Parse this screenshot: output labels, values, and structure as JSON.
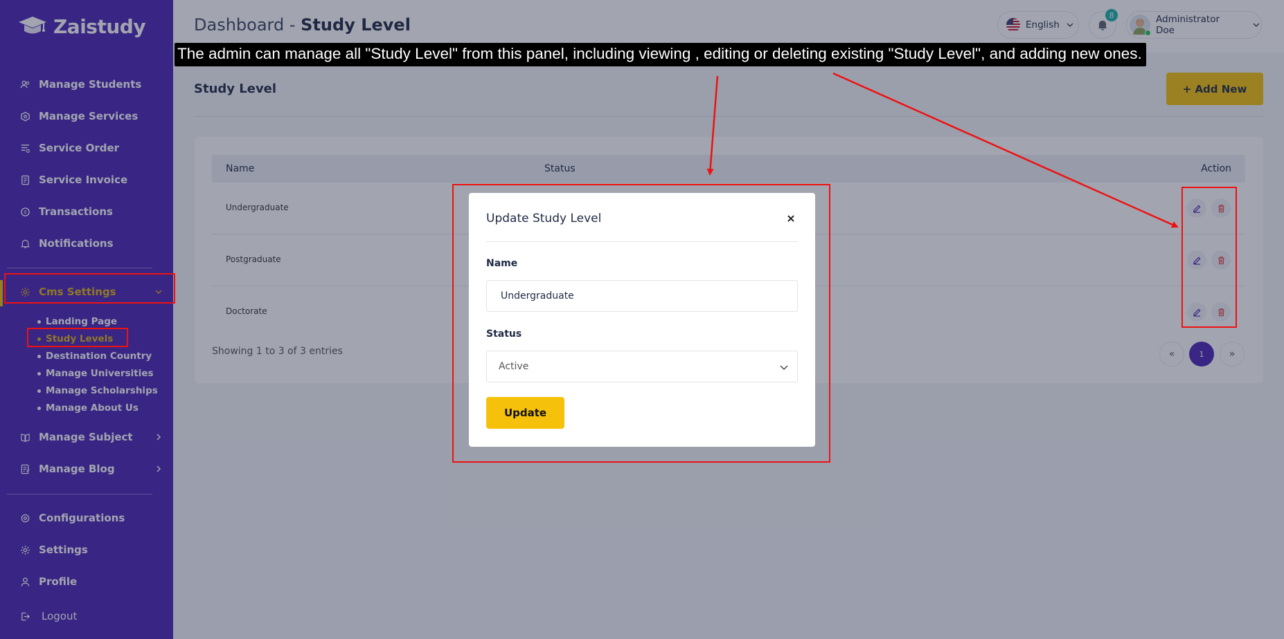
{
  "app": {
    "name": "Zaistudy",
    "logo_icon": "graduation-cap-logo"
  },
  "sidebar": {
    "items": [
      {
        "label": "Manage Students",
        "icon": "students-icon"
      },
      {
        "label": "Manage Services",
        "icon": "services-icon"
      },
      {
        "label": "Service Order",
        "icon": "order-icon"
      },
      {
        "label": "Service Invoice",
        "icon": "invoice-icon"
      },
      {
        "label": "Transactions",
        "icon": "transactions-icon"
      },
      {
        "label": "Notifications",
        "icon": "bell-icon"
      },
      {
        "label": "Cms Settings",
        "icon": "cog-icon",
        "expanded": true
      },
      {
        "label": "Manage Subject",
        "icon": "book-icon"
      },
      {
        "label": "Manage Blog",
        "icon": "blog-icon"
      },
      {
        "label": "Configurations",
        "icon": "configurations-icon"
      },
      {
        "label": "Settings",
        "icon": "settings-icon"
      },
      {
        "label": "Profile",
        "icon": "user-icon"
      },
      {
        "label": "Logout",
        "icon": "logout-icon"
      }
    ],
    "cms_sub_items": [
      {
        "label": "Landing Page"
      },
      {
        "label": "Study Levels",
        "current": true
      },
      {
        "label": "Destination Country"
      },
      {
        "label": "Manage Universities"
      },
      {
        "label": "Manage Scholarships"
      },
      {
        "label": "Manage About Us"
      }
    ]
  },
  "header": {
    "breadcrumb_root": "Dashboard",
    "separator": "-",
    "page": "Study Level",
    "language": "English",
    "notification_count": "8",
    "user_name": "Administrator Doe"
  },
  "content": {
    "section_title": "Study Level",
    "add_button": "+ Add New",
    "columns": {
      "name": "Name",
      "status": "Status",
      "action": "Action"
    },
    "rows": [
      {
        "name": "Undergraduate"
      },
      {
        "name": "Postgraduate"
      },
      {
        "name": "Doctorate"
      }
    ],
    "entries_info": "Showing 1 to 3 of 3 entries",
    "pagination": {
      "prev": "«",
      "current": "1",
      "next": "»"
    }
  },
  "modal": {
    "title": "Update Study Level",
    "name_label": "Name",
    "name_value": "Undergraduate",
    "status_label": "Status",
    "status_value": "Active",
    "submit": "Update"
  },
  "annotation": {
    "callout": "The admin can manage all \"Study Level\" from this panel, including viewing , editing or deleting existing \"Study Level\", and adding new ones."
  },
  "colors": {
    "sidebar": "#4a24b3",
    "accent": "#f3c20a",
    "annotation_red": "#ee1111",
    "badge": "#1bb0a8"
  }
}
